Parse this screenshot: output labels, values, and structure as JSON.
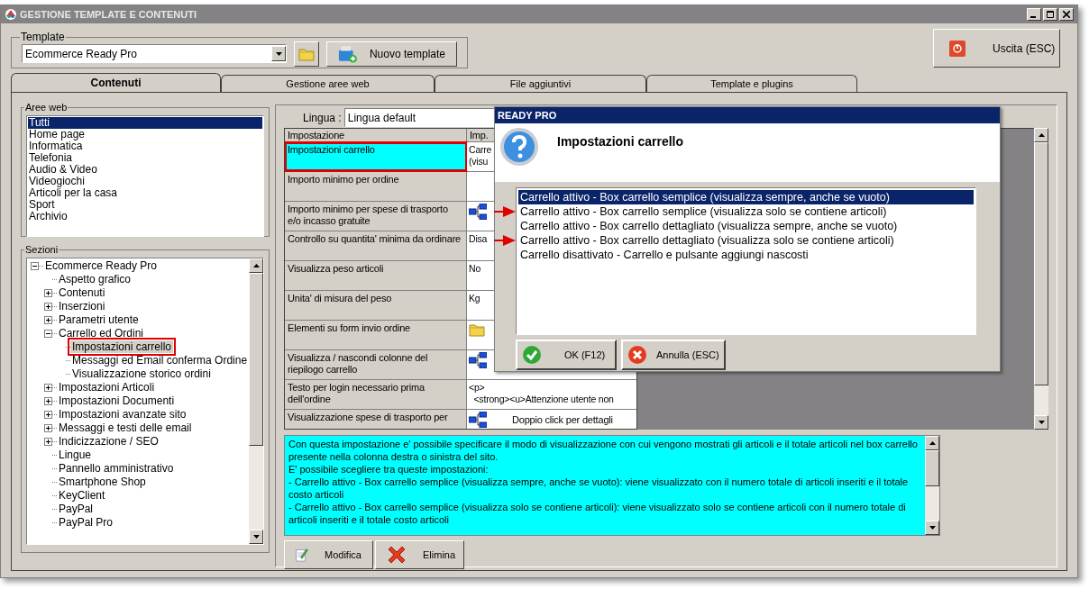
{
  "window": {
    "title": "GESTIONE TEMPLATE E CONTENUTI"
  },
  "template": {
    "group_label": "Template",
    "value": "Ecommerce Ready Pro",
    "new_button": "Nuovo template"
  },
  "exit_button": "Uscita (ESC)",
  "tabs": [
    {
      "label": "Contenuti",
      "selected": true
    },
    {
      "label": "Gestione aree web",
      "selected": false
    },
    {
      "label": "File aggiuntivi",
      "selected": false
    },
    {
      "label": "Template e plugins",
      "selected": false
    }
  ],
  "web_areas": {
    "label": "Aree web",
    "items": [
      {
        "label": "Tutti",
        "selected": true
      },
      {
        "label": "Home page",
        "selected": false
      },
      {
        "label": "Informatica",
        "selected": false
      },
      {
        "label": "Telefonia",
        "selected": false
      },
      {
        "label": "Audio & Video",
        "selected": false
      },
      {
        "label": "Videogiochi",
        "selected": false
      },
      {
        "label": "Articoli per la casa",
        "selected": false
      },
      {
        "label": "Sport",
        "selected": false
      },
      {
        "label": "Archivio",
        "selected": false
      }
    ]
  },
  "sections": {
    "label": "Sezioni",
    "tree": [
      {
        "label": "Ecommerce Ready Pro",
        "expanded": true,
        "selected": false,
        "highlighted": false,
        "children": [
          {
            "label": "Aspetto grafico",
            "selected": false,
            "highlighted": false
          },
          {
            "label": "Contenuti",
            "expanded": false,
            "selected": false,
            "highlighted": false
          },
          {
            "label": "Inserzioni",
            "expanded": false,
            "selected": false,
            "highlighted": false
          },
          {
            "label": "Parametri utente",
            "expanded": false,
            "selected": false,
            "highlighted": false
          },
          {
            "label": "Carrello ed Ordini",
            "expanded": true,
            "selected": false,
            "highlighted": false,
            "children": [
              {
                "label": "Impostazioni carrello",
                "selected": true,
                "highlighted": true
              },
              {
                "label": "Messaggi ed Email conferma Ordine",
                "selected": false,
                "highlighted": false
              },
              {
                "label": "Visualizzazione storico ordini",
                "selected": false,
                "highlighted": false
              }
            ]
          },
          {
            "label": "Impostazioni Articoli",
            "expanded": false,
            "selected": false,
            "highlighted": false
          },
          {
            "label": "Impostazioni Documenti",
            "expanded": false,
            "selected": false,
            "highlighted": false
          },
          {
            "label": "Impostazioni avanzate sito",
            "expanded": false,
            "selected": false,
            "highlighted": false
          },
          {
            "label": "Messaggi e testi delle email",
            "expanded": false,
            "selected": false,
            "highlighted": false
          },
          {
            "label": "Indicizzazione / SEO",
            "expanded": false,
            "selected": false,
            "highlighted": false
          },
          {
            "label": "Lingue",
            "selected": false,
            "highlighted": false
          },
          {
            "label": "Pannello amministrativo",
            "selected": false,
            "highlighted": false
          },
          {
            "label": "Smartphone Shop",
            "selected": false,
            "highlighted": false
          },
          {
            "label": "KeyClient",
            "selected": false,
            "highlighted": false
          },
          {
            "label": "PayPal",
            "selected": false,
            "highlighted": false
          },
          {
            "label": "PayPal Pro",
            "selected": false,
            "highlighted": false
          }
        ]
      }
    ]
  },
  "language": {
    "label": "Lingua :",
    "value": "Lingua default"
  },
  "table": {
    "columns": [
      "Impostazione",
      "Imp."
    ],
    "rows": [
      {
        "label": "Impostazioni carrello",
        "value": "Carre\n(visu",
        "kind": "text",
        "selected": true,
        "highlighted": true
      },
      {
        "label": "Importo minimo per ordine",
        "kind": "empty",
        "selected": false,
        "highlighted": false
      },
      {
        "label": "Importo minimo per spese di trasporto e/o incasso gratuite",
        "kind": "tree-icon",
        "selected": false,
        "highlighted": false
      },
      {
        "label": "Controllo su quantita' minima da ordinare",
        "value": "Disa",
        "kind": "text",
        "selected": false,
        "highlighted": false
      },
      {
        "label": "Visualizza peso articoli",
        "value": "No",
        "kind": "text",
        "selected": false,
        "highlighted": false
      },
      {
        "label": "Unita' di misura del peso",
        "value": "Kg",
        "kind": "text",
        "selected": false,
        "highlighted": false
      },
      {
        "label": "Elementi su form invio ordine",
        "kind": "folder-icon",
        "selected": false,
        "highlighted": false
      },
      {
        "label": "Visualizza / nascondi colonne del riepilogo carrello",
        "kind": "tree-icon",
        "selected": false,
        "highlighted": false
      },
      {
        "label": "Testo per login necessario prima dell'ordine",
        "value": "<p>\n  <strong><u>Attenzione utente non",
        "kind": "text",
        "selected": false,
        "highlighted": false
      },
      {
        "label": "Visualizzazione spese di trasporto per",
        "value": "Doppio click per dettagli",
        "kind": "tree-text",
        "selected": false,
        "highlighted": false
      }
    ]
  },
  "description": "Con questa impostazione e' possibile specificare il modo di visualizzazione con cui vengono mostrati gli articoli e il totale articoli nel box carrello presente nella colonna destra o sinistra del sito.\nE' possibile scegliere tra queste impostazioni:\n- Carrello attivo - Box carrello semplice (visualizza sempre, anche se vuoto): viene visualizzato con il numero totale di articoli inseriti e il totale costo articoli\n- Carrello attivo - Box carrello semplice (visualizza solo se contiene articoli): viene visualizzato solo se contiene articoli con il numero totale di articoli inseriti e il totale costo articoli",
  "actions": [
    {
      "label": "Modifica",
      "kind": "edit"
    },
    {
      "label": "Elimina",
      "kind": "delete"
    }
  ],
  "dialog": {
    "title": "READY PRO",
    "heading": "Impostazioni carrello",
    "options": [
      {
        "label": "Carrello attivo - Box carrello semplice (visualizza sempre, anche se vuoto)",
        "selected": true,
        "pointed": false
      },
      {
        "label": "Carrello attivo - Box carrello semplice (visualizza solo se contiene articoli)",
        "selected": false,
        "pointed": true
      },
      {
        "label": "Carrello attivo - Box carrello dettagliato (visualizza sempre, anche se vuoto)",
        "selected": false,
        "pointed": false
      },
      {
        "label": "Carrello attivo - Box carrello dettagliato (visualizza solo se contiene articoli)",
        "selected": false,
        "pointed": true
      },
      {
        "label": "Carrello disattivato - Carrello e pulsante aggiungi nascosti",
        "selected": false,
        "pointed": false
      }
    ],
    "buttons": [
      {
        "label": "OK (F12)",
        "kind": "ok"
      },
      {
        "label": "Annulla (ESC)",
        "kind": "cancel"
      }
    ]
  }
}
